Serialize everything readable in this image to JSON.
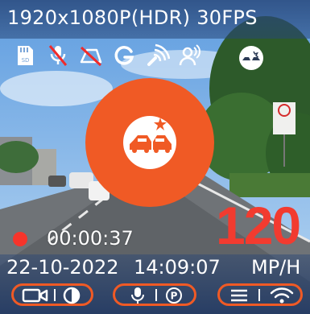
{
  "topbar": {
    "resolution_label": "1920x1080P(HDR) 30FPS"
  },
  "status_icons": [
    "sd-card-icon",
    "mic-off-icon",
    "parking-off-icon",
    "gps-icon",
    "wifi-signal-icon",
    "voice-control-icon",
    "collision-sensor-icon"
  ],
  "center_button": {
    "icon": "collision-icon",
    "color": "#f05a25"
  },
  "recording": {
    "dot_color": "#f6342b",
    "elapsed": "00:00:37"
  },
  "speed": {
    "value": "120",
    "color": "#f23b2f"
  },
  "datetime": {
    "date": "22-10-2022",
    "time": "14:09:07",
    "units": "MP/H"
  },
  "controls": {
    "accent_color": "#f05a25",
    "groups": [
      {
        "left_icon": "video-camera-icon",
        "right_icon": "contrast-icon"
      },
      {
        "left_icon": "microphone-icon",
        "right_icon": "parking-icon"
      },
      {
        "left_icon": "menu-icon",
        "right_icon": "wifi-icon"
      }
    ]
  }
}
